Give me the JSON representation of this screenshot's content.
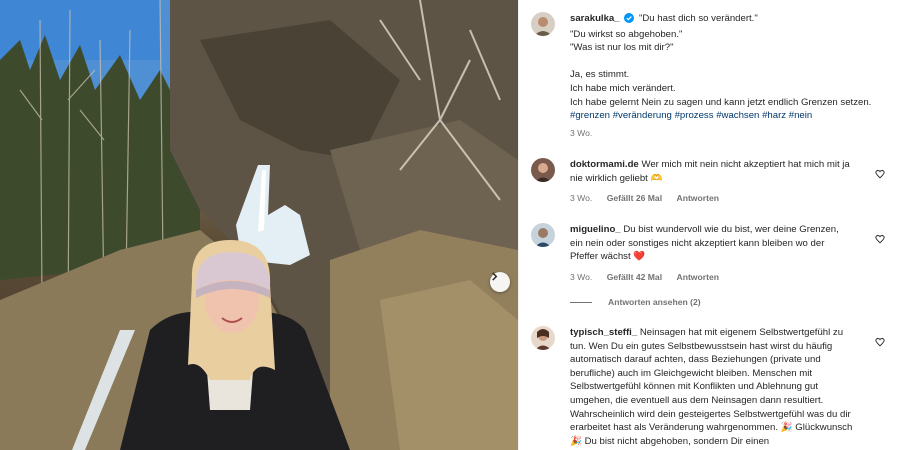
{
  "caption": {
    "username": "sarakulka_",
    "lines": [
      "\"Du hast dich so verändert.\"",
      "\"Du wirkst so abgehoben.\"",
      "\"Was ist nur los mit dir?\"",
      "",
      "Ja, es stimmt.",
      "Ich habe mich verändert.",
      "Ich habe gelernt Nein zu sagen und kann jetzt endlich Grenzen setzen."
    ],
    "hashtags": [
      "#grenzen",
      "#veränderung",
      "#prozess",
      "#wachsen",
      "#harz",
      "#nein"
    ],
    "time": "3 Wo."
  },
  "comments": [
    {
      "username": "doktormami.de",
      "text": "Wer mich mit nein nicht akzeptiert hat mich mit ja nie wirklich geliebt 🫶",
      "time": "3 Wo.",
      "likes": "Gefällt 26 Mal",
      "reply": "Antworten"
    },
    {
      "username": "miguelino_",
      "text": "Du bist wundervoll wie du bist, wer deine Grenzen, ein nein oder sonstiges nicht akzeptiert kann bleiben wo der Pfeffer wächst ❤️",
      "time": "3 Wo.",
      "likes": "Gefällt 42 Mal",
      "reply": "Antworten",
      "view_replies": "Antworten ansehen (2)"
    },
    {
      "username": "typisch_steffi_",
      "text": "Neinsagen hat mit eigenem Selbstwertgefühl zu tun. Wen Du ein gutes Selbstbewusstsein hast wirst du häufig automatisch darauf achten, dass Beziehungen (private und berufliche) auch im Gleichgewicht bleiben. Menschen mit Selbstwertgefühl können mit Konflikten und Ablehnung gut umgehen, die eventuell aus dem Neinsagen dann resultiert. Wahrscheinlich wird dein gesteigertes Selbstwertgefühl was du dir erarbeitet hast als Veränderung wahrgenommen. 🎉 Glückwunsch 🎉 Du bist nicht abgehoben, sondern Dir einen"
    }
  ],
  "icons": {
    "verified": "verified-badge-icon",
    "heart": "heart-outline-icon",
    "next": "chevron-right-icon"
  },
  "colors": {
    "hashtag": "#00376b",
    "verified": "#0095f6",
    "secondary_text": "#737373"
  }
}
